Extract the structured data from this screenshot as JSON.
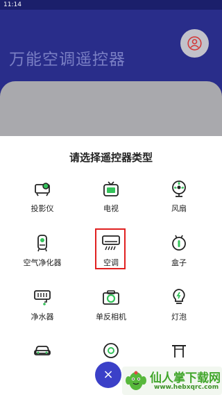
{
  "status_bar": {
    "time": "11:14"
  },
  "header": {
    "app_title": "万能空调遥控器"
  },
  "sheet": {
    "title": "请选择遥控器类型",
    "devices": [
      {
        "label": "投影仪",
        "icon": "projector-icon"
      },
      {
        "label": "电视",
        "icon": "tv-icon"
      },
      {
        "label": "风扇",
        "icon": "fan-icon"
      },
      {
        "label": "空气净化器",
        "icon": "air-purifier-icon"
      },
      {
        "label": "空调",
        "icon": "air-conditioner-icon"
      },
      {
        "label": "盒子",
        "icon": "set-top-box-icon"
      },
      {
        "label": "净水器",
        "icon": "water-purifier-icon"
      },
      {
        "label": "单反相机",
        "icon": "camera-icon"
      },
      {
        "label": "灯泡",
        "icon": "light-bulb-icon"
      },
      {
        "label": "",
        "icon": "car-icon"
      },
      {
        "label": "",
        "icon": "robot-vacuum-icon"
      },
      {
        "label": "",
        "icon": "gate-icon"
      }
    ],
    "close_label": "×"
  },
  "watermark": {
    "name": "仙人掌下载网",
    "url": "www.hebxqrc.com"
  },
  "colors": {
    "header": "#292d8a",
    "accent": "#3b40c8",
    "icon_green": "#34c25a",
    "highlight": "#e02020"
  }
}
